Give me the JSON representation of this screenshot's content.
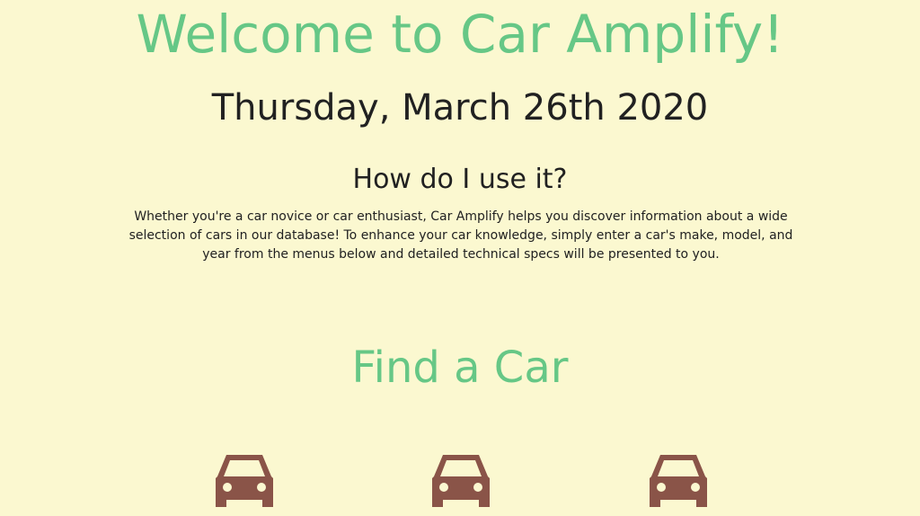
{
  "header": {
    "title": "Welcome to Car Amplify!",
    "date": "Thursday, March 26th 2020"
  },
  "intro": {
    "heading": "How do I use it?",
    "description": "Whether you're a car novice or car enthusiast, Car Amplify helps you discover information about a wide selection of cars in our database! To enhance your car knowledge, simply enter a car's make, model, and year from the menus below and detailed technical specs will be presented to you."
  },
  "finder": {
    "heading": "Find a Car",
    "icons": [
      "car-icon",
      "car-icon",
      "car-icon"
    ]
  },
  "colors": {
    "background": "#fbf8d0",
    "accent_green": "#66c786",
    "text": "#212121",
    "icon_brown": "#8a5448"
  }
}
